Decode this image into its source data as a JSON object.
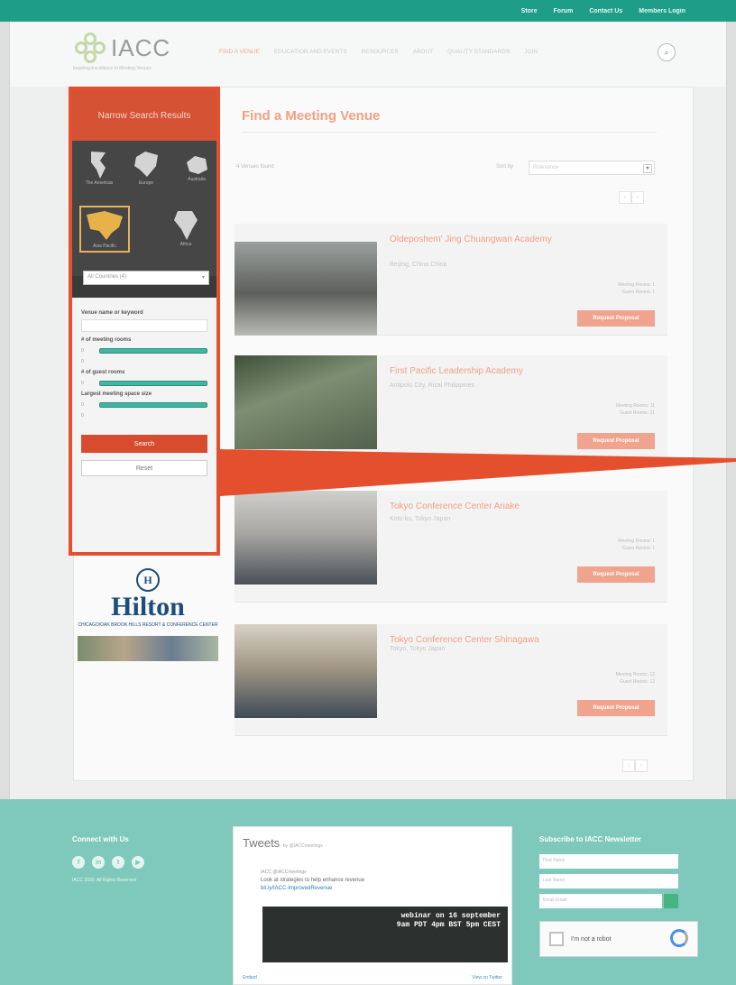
{
  "topbar": {
    "links": [
      "Store",
      "Forum",
      "Contact Us",
      "Members Login"
    ]
  },
  "brand": {
    "name": "IACC",
    "tagline": "Inspiring Excellence in Meeting Venues"
  },
  "nav": {
    "items": [
      "Find a Venue",
      "Education and Events",
      "Resources",
      "About",
      "Quality Standards",
      "Join"
    ],
    "active": 0
  },
  "sidebar": {
    "header": "Narrow Search Results",
    "regions": [
      "The Americas",
      "Europe",
      "Australia",
      "Asia Pacific",
      "Africa"
    ],
    "selected_region": "Asia Pacific",
    "country_select": "All Countries (4)",
    "keyword_label": "Venue name or keyword",
    "meeting_rooms_label": "# of meeting rooms",
    "guest_rooms_label": "# of guest rooms",
    "largest_space_label": "Largest meeting space size",
    "slider_values": [
      "0",
      "0",
      "0",
      "0",
      "0"
    ],
    "search_button": "Search",
    "reset_button": "Reset"
  },
  "ad": {
    "logo_letter": "H",
    "brand": "Hilton",
    "subtitle": "CHICAGO/OAK BROOK HILLS RESORT & CONFERENCE CENTER"
  },
  "main": {
    "title": "Find a Meeting Venue",
    "results_count": "4 Venues found",
    "sort_label": "Sort by",
    "sort_value": "Relevance",
    "venues": [
      {
        "name": "Oldeposhem' Jing Chuangwan Academy",
        "location": "Beijing, China China",
        "rooms": "Meeting Rooms: 1",
        "guest": "Guest Rooms: 1",
        "cta": "Request Proposal"
      },
      {
        "name": "First Pacific Leadership Academy",
        "location": "Antipolo City, Rizal Philippines",
        "rooms": "Meeting Rooms: 11",
        "guest": "Guest Rooms: 31",
        "cta": "Request Proposal"
      },
      {
        "name": "Tokyo Conference Center Ariake",
        "location": "Koto-ku, Tokyo Japan",
        "rooms": "Meeting Rooms: 1",
        "guest": "Guest Rooms: 1",
        "cta": "Request Proposal"
      },
      {
        "name": "Tokyo Conference Center Shinagawa",
        "location": "Tokyo, Tokyo Japan",
        "rooms": "Meeting Rooms: 12",
        "guest": "Guest Rooms: 12",
        "cta": "Request Proposal"
      }
    ]
  },
  "footer": {
    "connect_title": "Connect with Us",
    "copyright": "IACC 2020. All Rights Reserved",
    "tweets_title": "Tweets",
    "tweets_by": "by @IACCmeetings",
    "tweet_author": "IACC @IACCmeetings",
    "tweet_text": "Look at strategies to help enhance revenue",
    "tweet_link": "bit.ly/IACC-ImprovedRevenue",
    "tweet_image_text": "webinar on 16 september\n9am PDT 4pm BST 5pm CEST",
    "tweets_embed": "Embed",
    "tweets_view": "View on Twitter",
    "newsletter_title": "Subscribe to IACC Newsletter",
    "first_name": "First Name",
    "last_name": "Last Name",
    "email": "Email Email",
    "captcha": "I'm not a robot"
  }
}
